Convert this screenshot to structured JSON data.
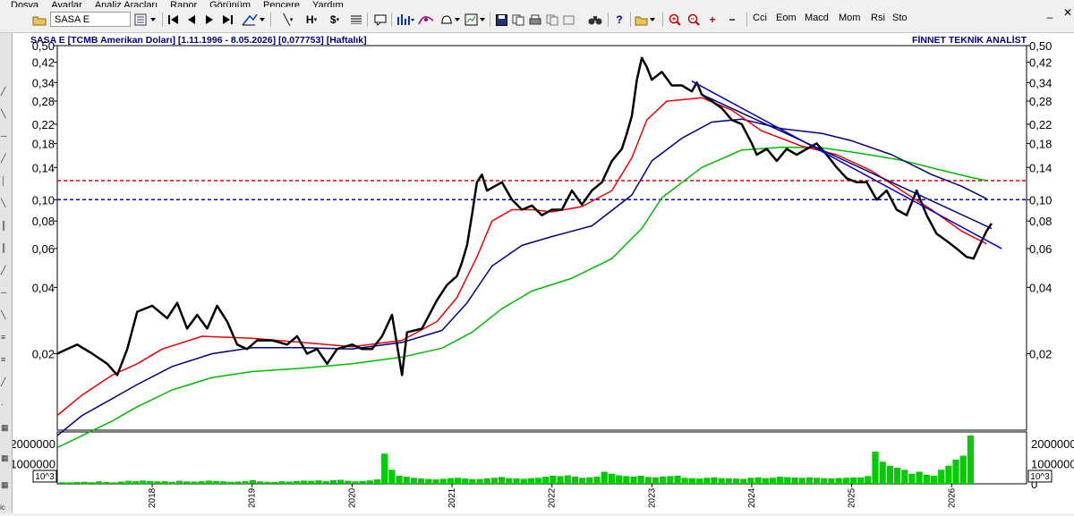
{
  "menu": [
    "Dosya",
    "Ayarlar",
    "Analiz Araçları",
    "Rapor",
    "Görünüm",
    "Pencere",
    "Yardım"
  ],
  "toolbar": {
    "symbol_value": "SASA  E",
    "icons": [
      "open-icon",
      "interval-icon",
      "first-icon",
      "prev-icon",
      "next-icon",
      "last-icon",
      "draw-tools-icon",
      "line-icon",
      "horizontal-line-icon",
      "dollar-icon",
      "list-icon",
      "comment-icon",
      "chart-type-icon",
      "settings-icon",
      "alarm-icon",
      "template-icon",
      "save-icon",
      "copy-icon",
      "print-icon",
      "binoculars-icon",
      "help-icon",
      "folder-icon",
      "zoom-in-icon",
      "zoom-out-icon",
      "plus-icon",
      "minus-icon"
    ],
    "indicators": [
      "Cci",
      "Eom",
      "Macd",
      "Mom",
      "Rsi",
      "Sto"
    ]
  },
  "chart": {
    "header": "SASA  E  [TCMB Amerikan Doları]  [1.11.1996 - 8.05.2026]  [0,077753]  [Haftalık]",
    "brand": "FİNNET TEKNİK ANALİST",
    "volume_unit": "10^3",
    "left_edge_label": "ic"
  },
  "chart_data": {
    "type": "line",
    "y_scale": "log",
    "ylim": [
      0.009,
      0.5
    ],
    "xlim": [
      2017.05,
      2026.75
    ],
    "x_ticks": [
      "2018",
      "2019",
      "2020",
      "2021",
      "2022",
      "2023",
      "2024",
      "2025",
      "2026"
    ],
    "y_ticks_left": [
      "0,50",
      "0,42",
      "0,34",
      "0,28",
      "0,22",
      "0,18",
      "0,14",
      "0,10",
      "0,08",
      "0,06",
      "0,04",
      "0,02"
    ],
    "y_ticks_right": [
      "0,50",
      "0,42",
      "0,34",
      "0,28",
      "0,22",
      "0,18",
      "0,14",
      "0,10",
      "0,08",
      "0,06",
      "0,04",
      "0,02"
    ],
    "y_tick_values": [
      0.5,
      0.42,
      0.34,
      0.28,
      0.22,
      0.18,
      0.14,
      0.1,
      0.08,
      0.06,
      0.04,
      0.02
    ],
    "volume_ticks_left": [
      "2000000",
      "1000000"
    ],
    "volume_ticks_right": [
      "2000000",
      "1000000",
      "0"
    ],
    "volume_tick_values": [
      2000000,
      1000000,
      0
    ],
    "series": [
      {
        "color": "#000000",
        "width": 2.5,
        "points": [
          [
            2017.05,
            0.02
          ],
          [
            2017.15,
            0.021
          ],
          [
            2017.25,
            0.022
          ],
          [
            2017.4,
            0.02
          ],
          [
            2017.55,
            0.018
          ],
          [
            2017.65,
            0.016
          ],
          [
            2017.75,
            0.021
          ],
          [
            2017.85,
            0.031
          ],
          [
            2018.0,
            0.033
          ],
          [
            2018.15,
            0.029
          ],
          [
            2018.25,
            0.034
          ],
          [
            2018.35,
            0.026
          ],
          [
            2018.45,
            0.03
          ],
          [
            2018.55,
            0.026
          ],
          [
            2018.65,
            0.033
          ],
          [
            2018.75,
            0.028
          ],
          [
            2018.85,
            0.022
          ],
          [
            2018.95,
            0.021
          ],
          [
            2019.05,
            0.023
          ],
          [
            2019.2,
            0.023
          ],
          [
            2019.35,
            0.022
          ],
          [
            2019.45,
            0.024
          ],
          [
            2019.55,
            0.02
          ],
          [
            2019.65,
            0.021
          ],
          [
            2019.75,
            0.018
          ],
          [
            2019.85,
            0.021
          ],
          [
            2020.0,
            0.022
          ],
          [
            2020.1,
            0.021
          ],
          [
            2020.2,
            0.021
          ],
          [
            2020.3,
            0.024
          ],
          [
            2020.4,
            0.03
          ],
          [
            2020.45,
            0.022
          ],
          [
            2020.5,
            0.016
          ],
          [
            2020.55,
            0.025
          ],
          [
            2020.7,
            0.026
          ],
          [
            2020.85,
            0.035
          ],
          [
            2020.95,
            0.041
          ],
          [
            2021.05,
            0.045
          ],
          [
            2021.1,
            0.052
          ],
          [
            2021.15,
            0.062
          ],
          [
            2021.2,
            0.085
          ],
          [
            2021.25,
            0.12
          ],
          [
            2021.3,
            0.13
          ],
          [
            2021.35,
            0.11
          ],
          [
            2021.5,
            0.12
          ],
          [
            2021.6,
            0.1
          ],
          [
            2021.7,
            0.09
          ],
          [
            2021.8,
            0.094
          ],
          [
            2021.9,
            0.085
          ],
          [
            2022.0,
            0.09
          ],
          [
            2022.1,
            0.09
          ],
          [
            2022.2,
            0.11
          ],
          [
            2022.3,
            0.095
          ],
          [
            2022.4,
            0.11
          ],
          [
            2022.5,
            0.12
          ],
          [
            2022.6,
            0.15
          ],
          [
            2022.7,
            0.17
          ],
          [
            2022.75,
            0.2
          ],
          [
            2022.8,
            0.24
          ],
          [
            2022.85,
            0.35
          ],
          [
            2022.9,
            0.44
          ],
          [
            2022.95,
            0.4
          ],
          [
            2023.0,
            0.35
          ],
          [
            2023.1,
            0.38
          ],
          [
            2023.2,
            0.33
          ],
          [
            2023.3,
            0.33
          ],
          [
            2023.4,
            0.31
          ],
          [
            2023.45,
            0.34
          ],
          [
            2023.5,
            0.3
          ],
          [
            2023.6,
            0.28
          ],
          [
            2023.7,
            0.26
          ],
          [
            2023.8,
            0.23
          ],
          [
            2023.9,
            0.22
          ],
          [
            2024.0,
            0.18
          ],
          [
            2024.05,
            0.16
          ],
          [
            2024.15,
            0.17
          ],
          [
            2024.25,
            0.15
          ],
          [
            2024.35,
            0.17
          ],
          [
            2024.45,
            0.16
          ],
          [
            2024.55,
            0.17
          ],
          [
            2024.65,
            0.18
          ],
          [
            2024.75,
            0.16
          ],
          [
            2024.85,
            0.14
          ],
          [
            2024.95,
            0.125
          ],
          [
            2025.05,
            0.12
          ],
          [
            2025.15,
            0.12
          ],
          [
            2025.25,
            0.1
          ],
          [
            2025.35,
            0.11
          ],
          [
            2025.45,
            0.09
          ],
          [
            2025.55,
            0.085
          ],
          [
            2025.65,
            0.11
          ],
          [
            2025.75,
            0.085
          ],
          [
            2025.85,
            0.07
          ],
          [
            2025.95,
            0.065
          ],
          [
            2026.05,
            0.06
          ],
          [
            2026.15,
            0.055
          ],
          [
            2026.22,
            0.054
          ],
          [
            2026.28,
            0.062
          ],
          [
            2026.35,
            0.072
          ],
          [
            2026.4,
            0.078
          ]
        ]
      },
      {
        "color": "#ee0000",
        "width": 1.5,
        "points": [
          [
            2017.05,
            0.0105
          ],
          [
            2017.3,
            0.013
          ],
          [
            2017.6,
            0.016
          ],
          [
            2017.85,
            0.018
          ],
          [
            2018.1,
            0.021
          ],
          [
            2018.5,
            0.024
          ],
          [
            2019.0,
            0.0235
          ],
          [
            2019.5,
            0.0225
          ],
          [
            2020.0,
            0.0215
          ],
          [
            2020.5,
            0.023
          ],
          [
            2020.85,
            0.028
          ],
          [
            2021.05,
            0.036
          ],
          [
            2021.25,
            0.055
          ],
          [
            2021.4,
            0.08
          ],
          [
            2021.6,
            0.09
          ],
          [
            2021.8,
            0.09
          ],
          [
            2022.0,
            0.088
          ],
          [
            2022.3,
            0.093
          ],
          [
            2022.6,
            0.11
          ],
          [
            2022.8,
            0.155
          ],
          [
            2022.95,
            0.23
          ],
          [
            2023.15,
            0.28
          ],
          [
            2023.5,
            0.29
          ],
          [
            2023.8,
            0.255
          ],
          [
            2024.1,
            0.205
          ],
          [
            2024.5,
            0.175
          ],
          [
            2024.85,
            0.16
          ],
          [
            2025.2,
            0.135
          ],
          [
            2025.5,
            0.11
          ],
          [
            2025.8,
            0.09
          ],
          [
            2026.1,
            0.072
          ],
          [
            2026.35,
            0.063
          ]
        ]
      },
      {
        "color": "#000080",
        "width": 1.5,
        "points": [
          [
            2017.05,
            0.0085
          ],
          [
            2017.3,
            0.0105
          ],
          [
            2017.6,
            0.0125
          ],
          [
            2017.85,
            0.0145
          ],
          [
            2018.2,
            0.0175
          ],
          [
            2018.6,
            0.02
          ],
          [
            2019.0,
            0.0213
          ],
          [
            2019.5,
            0.0213
          ],
          [
            2020.0,
            0.021
          ],
          [
            2020.5,
            0.0225
          ],
          [
            2020.9,
            0.0255
          ],
          [
            2021.15,
            0.034
          ],
          [
            2021.4,
            0.05
          ],
          [
            2021.7,
            0.062
          ],
          [
            2022.0,
            0.068
          ],
          [
            2022.4,
            0.076
          ],
          [
            2022.8,
            0.105
          ],
          [
            2023.0,
            0.15
          ],
          [
            2023.3,
            0.19
          ],
          [
            2023.6,
            0.225
          ],
          [
            2023.9,
            0.232
          ],
          [
            2024.3,
            0.21
          ],
          [
            2024.7,
            0.2
          ],
          [
            2025.0,
            0.185
          ],
          [
            2025.4,
            0.16
          ],
          [
            2025.8,
            0.13
          ],
          [
            2026.1,
            0.115
          ],
          [
            2026.35,
            0.101
          ]
        ]
      },
      {
        "color": "#00bb00",
        "width": 1.5,
        "points": [
          [
            2017.05,
            0.0075
          ],
          [
            2017.3,
            0.0085
          ],
          [
            2017.6,
            0.0099
          ],
          [
            2017.85,
            0.0115
          ],
          [
            2018.2,
            0.0137
          ],
          [
            2018.6,
            0.0156
          ],
          [
            2019.0,
            0.0166
          ],
          [
            2019.5,
            0.0172
          ],
          [
            2020.0,
            0.018
          ],
          [
            2020.5,
            0.0193
          ],
          [
            2020.9,
            0.0212
          ],
          [
            2021.2,
            0.025
          ],
          [
            2021.5,
            0.032
          ],
          [
            2021.8,
            0.0385
          ],
          [
            2022.2,
            0.044
          ],
          [
            2022.6,
            0.054
          ],
          [
            2022.9,
            0.074
          ],
          [
            2023.1,
            0.102
          ],
          [
            2023.5,
            0.14
          ],
          [
            2023.9,
            0.168
          ],
          [
            2024.3,
            0.173
          ],
          [
            2024.7,
            0.172
          ],
          [
            2025.1,
            0.162
          ],
          [
            2025.5,
            0.151
          ],
          [
            2025.9,
            0.136
          ],
          [
            2026.2,
            0.126
          ],
          [
            2026.35,
            0.122
          ]
        ]
      }
    ],
    "trendlines": [
      {
        "color": "#0000cc",
        "from": [
          2023.4,
          0.345
        ],
        "to": [
          2026.5,
          0.06
        ]
      },
      {
        "color": "#000080",
        "from": [
          2023.5,
          0.3
        ],
        "to": [
          2026.4,
          0.074
        ]
      }
    ],
    "hlines": [
      {
        "color": "#dd0000",
        "value": 0.122
      },
      {
        "color": "#0000cc",
        "value": 0.1
      }
    ],
    "volume": {
      "color": "#00cc00",
      "max": 2400000,
      "values": [
        80000,
        70000,
        90000,
        100000,
        80000,
        120000,
        90000,
        70000,
        110000,
        150000,
        130000,
        160000,
        140000,
        120000,
        130000,
        100000,
        150000,
        120000,
        110000,
        130000,
        160000,
        140000,
        120000,
        100000,
        110000,
        130000,
        180000,
        120000,
        100000,
        90000,
        130000,
        110000,
        140000,
        160000,
        150000,
        170000,
        130000,
        180000,
        200000,
        150000,
        120000,
        140000,
        170000,
        220000,
        1500000,
        700000,
        400000,
        350000,
        300000,
        260000,
        240000,
        220000,
        250000,
        280000,
        300000,
        260000,
        230000,
        240000,
        270000,
        300000,
        340000,
        280000,
        260000,
        250000,
        280000,
        300000,
        350000,
        400000,
        380000,
        420000,
        360000,
        300000,
        320000,
        350000,
        600000,
        500000,
        420000,
        380000,
        360000,
        400000,
        340000,
        320000,
        360000,
        380000,
        400000,
        300000,
        280000,
        260000,
        300000,
        320000,
        280000,
        270000,
        260000,
        250000,
        300000,
        320000,
        280000,
        300000,
        350000,
        330000,
        310000,
        300000,
        320000,
        300000,
        280000,
        270000,
        290000,
        300000,
        310000,
        320000,
        380000,
        1600000,
        1100000,
        900000,
        800000,
        700000,
        500000,
        600000,
        450000,
        400000,
        700000,
        900000,
        1200000,
        1400000,
        2400000
      ]
    }
  }
}
